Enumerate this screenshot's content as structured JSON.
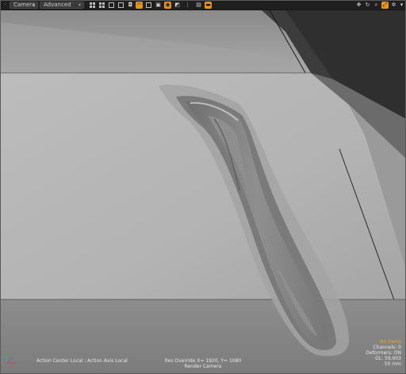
{
  "toolbar": {
    "view_dropdown": "Camera",
    "shading_dropdown": "Advanced",
    "icons": [
      "grid-icon",
      "wire-icon",
      "solid-icon",
      "texture-icon",
      "camera-icon",
      "light-icon",
      "shading-icon",
      "backdrop-icon",
      "render-icon",
      "preview-icon",
      "options-icon"
    ],
    "right_icons": [
      "move-icon",
      "rotate-icon",
      "zoom-icon",
      "fit-icon",
      "settings-icon"
    ]
  },
  "hud": {
    "selection": "No Items",
    "channels": "Channels: 0",
    "deformers": "Deformers: ON",
    "gl": "GL: 59,903",
    "lens": "50 mm",
    "res_override": "Res Override  X= 1920, Y= 1080",
    "render_camera": "Render Camera",
    "action_center": "Action Center Local : Action Axis Local"
  },
  "colors": {
    "accent": "#e8951c",
    "viewport_bg": "#3f3f3f",
    "surface_light": "#b9b9b9",
    "surface_mid": "#a6a6a6"
  }
}
